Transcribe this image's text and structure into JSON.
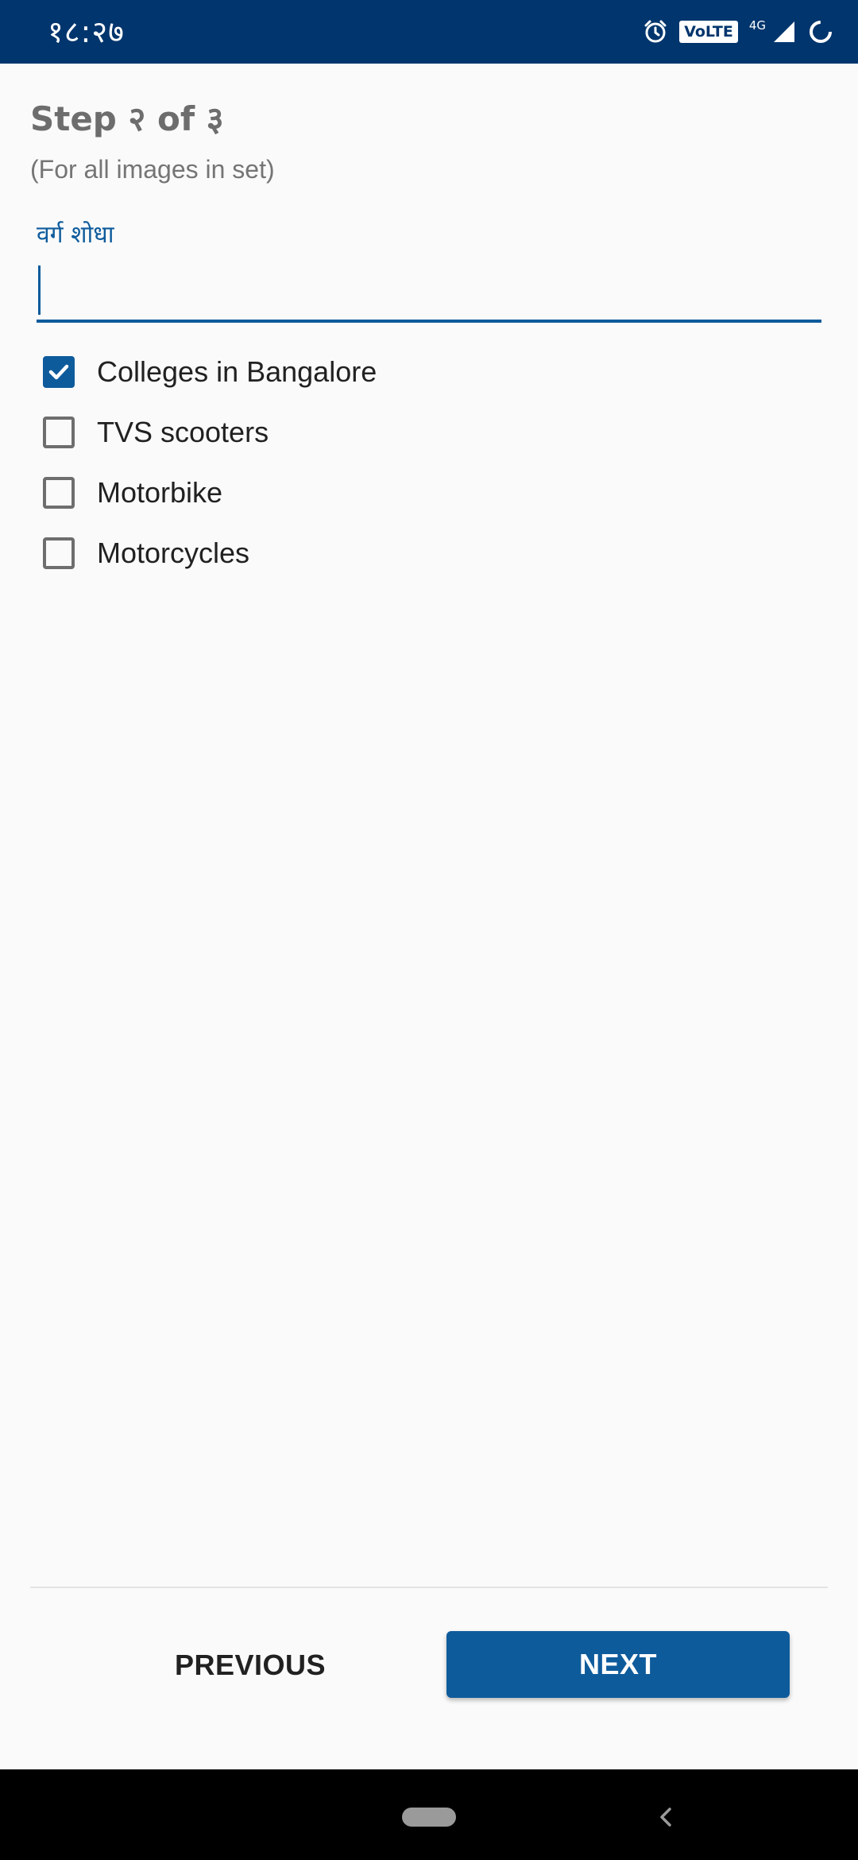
{
  "status_bar": {
    "time": "१८:२७",
    "volte": "VoLTE",
    "network": "4G",
    "icons": [
      "alarm-icon",
      "volte-icon",
      "signal-icon",
      "battery-icon"
    ]
  },
  "header": {
    "step": "Step २ of ३",
    "subtitle": "(For all images in set)"
  },
  "search": {
    "label": "वर्ग शोधा",
    "value": "",
    "placeholder": ""
  },
  "categories": [
    {
      "label": "Colleges in Bangalore",
      "checked": true
    },
    {
      "label": "TVS scooters",
      "checked": false
    },
    {
      "label": "Motorbike",
      "checked": false
    },
    {
      "label": "Motorcycles",
      "checked": false
    }
  ],
  "footer": {
    "previous_label": "PREVIOUS",
    "next_label": "NEXT"
  },
  "colors": {
    "status_bar": "#00356d",
    "accent": "#0e5b9c",
    "background": "#fafafa"
  }
}
